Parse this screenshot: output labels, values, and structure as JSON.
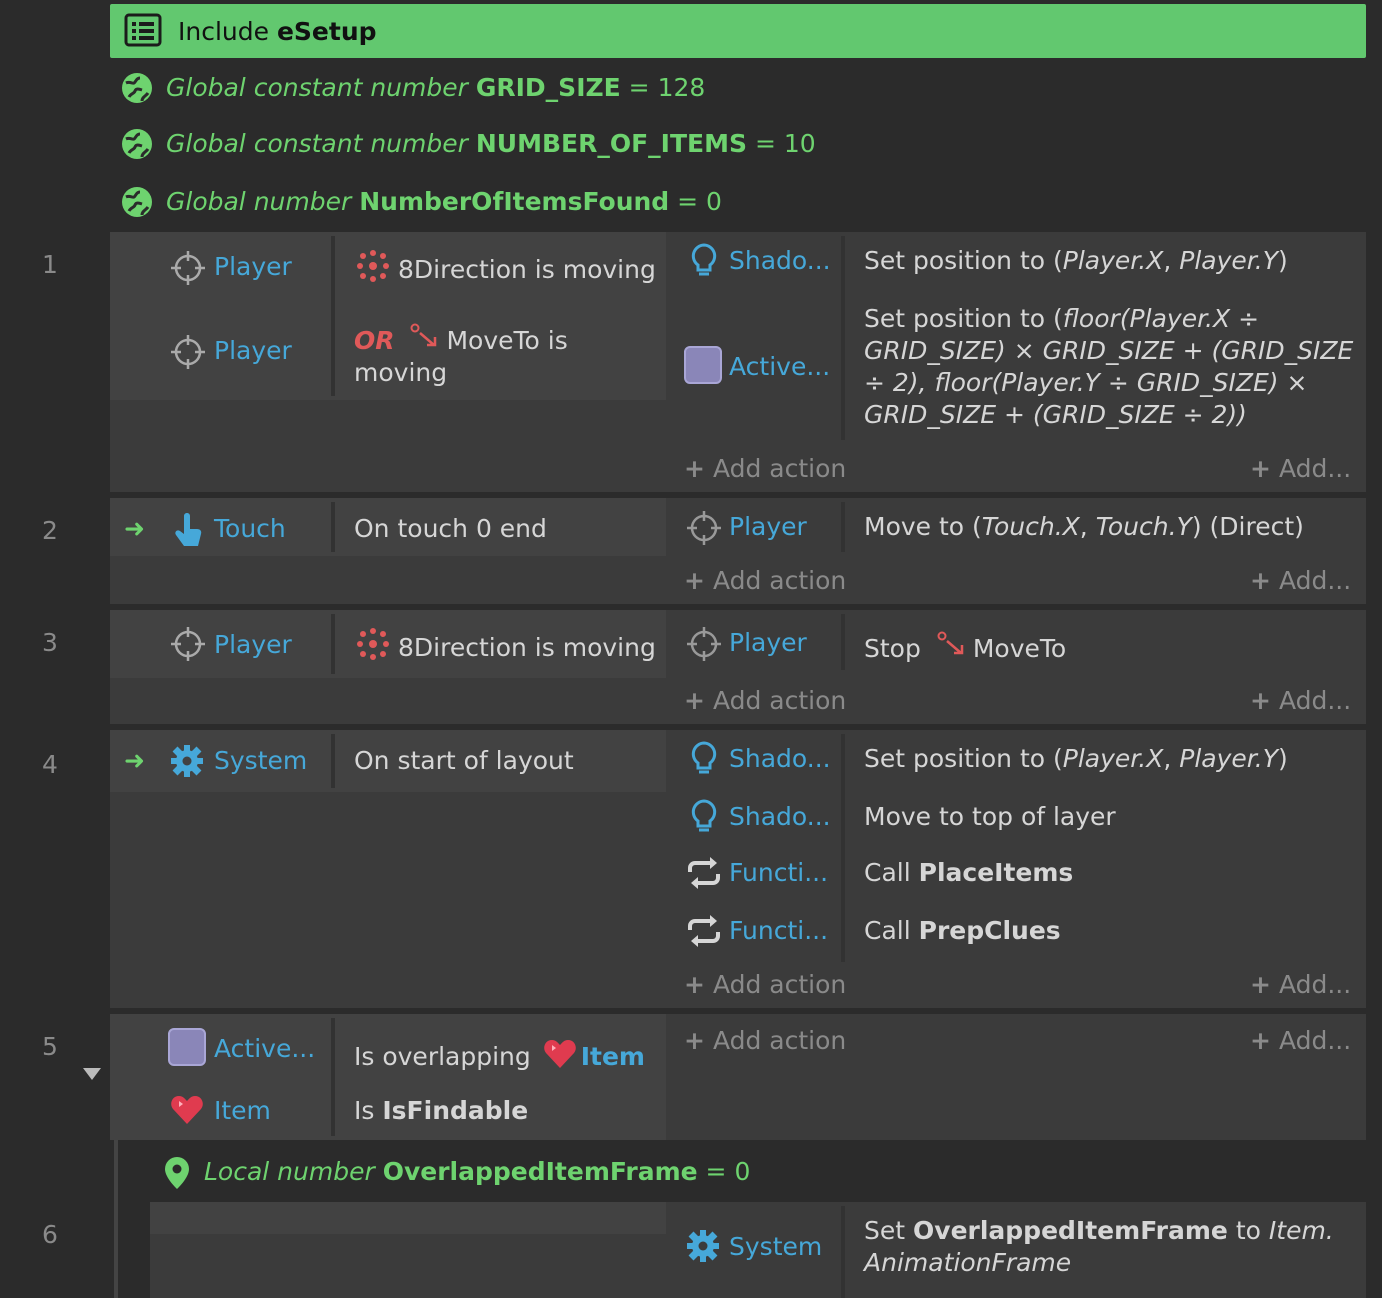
{
  "include": {
    "label": "Include",
    "name": "eSetup"
  },
  "globals": [
    {
      "kind": "Global constant number",
      "name": "GRID_SIZE",
      "eq": "=",
      "value": "128"
    },
    {
      "kind": "Global constant number",
      "name": "NUMBER_OF_ITEMS",
      "eq": "=",
      "value": "10"
    },
    {
      "kind": "Global number",
      "name": "NumberOfItemsFound",
      "eq": "=",
      "value": "0"
    }
  ],
  "common": {
    "add_action": "Add action",
    "add_more": "Add...",
    "or_label": "OR"
  },
  "events": {
    "e1": {
      "num": "1",
      "c1_obj": "Player",
      "c1_text": "8Direction is moving",
      "c2_obj": "Player",
      "c2_text_a": "MoveTo is",
      "c2_text_b": "moving",
      "a1_obj": "Shado...",
      "a1_pre": "Set position to (",
      "a1_x": "Player.X",
      "a1_sep": ", ",
      "a1_y": "Player.Y",
      "a1_post": ")",
      "a2_obj": "Active...",
      "a2_l1_pre": "Set position to (",
      "a2_l1_i": "floor(Player.X ÷",
      "a2_l2": "GRID_SIZE) × GRID_SIZE + (GRID_SIZE",
      "a2_l3": "÷ 2), floor(Player.Y ÷ GRID_SIZE) ×",
      "a2_l4": "GRID_SIZE + (GRID_SIZE ÷ 2))"
    },
    "e2": {
      "num": "2",
      "c1_obj": "Touch",
      "c1_text": "On touch 0 end",
      "a1_obj": "Player",
      "a1_pre": "Move to (",
      "a1_x": "Touch.X",
      "a1_sep": ", ",
      "a1_y": "Touch.Y",
      "a1_post": ") (Direct)"
    },
    "e3": {
      "num": "3",
      "c1_obj": "Player",
      "c1_text": "8Direction is moving",
      "a1_obj": "Player",
      "a1_pre": "Stop",
      "a1_post": "MoveTo"
    },
    "e4": {
      "num": "4",
      "c1_obj": "System",
      "c1_text": "On start of layout",
      "a1_obj": "Shado...",
      "a1_pre": "Set position to (",
      "a1_x": "Player.X",
      "a1_sep": ", ",
      "a1_y": "Player.Y",
      "a1_post": ")",
      "a2_obj": "Shado...",
      "a2_text": "Move to top of layer",
      "a3_obj": "Functi...",
      "a3_pre": "Call",
      "a3_name": "PlaceItems",
      "a4_obj": "Functi...",
      "a4_pre": "Call",
      "a4_name": "PrepClues"
    },
    "e5": {
      "num": "5",
      "c1_obj": "Active...",
      "c1_pre": "Is overlapping",
      "c1_target": "Item",
      "c2_obj": "Item",
      "c2_pre": "Is",
      "c2_name": "IsFindable"
    },
    "local": {
      "kind": "Local number",
      "name": "OverlappedItemFrame",
      "eq": "=",
      "value": "0"
    },
    "e6": {
      "num": "6",
      "a1_obj": "System",
      "a1_pre": "Set",
      "a1_name": "OverlappedItemFrame",
      "a1_mid": "to",
      "a1_i1": "Item.",
      "a1_i2": "AnimationFrame"
    }
  },
  "colors": {
    "include_bar": "#62c86f",
    "globals": "#6ed36f",
    "object": "#46a8d9",
    "or": "#e05959",
    "background": "#2b2b2b"
  }
}
